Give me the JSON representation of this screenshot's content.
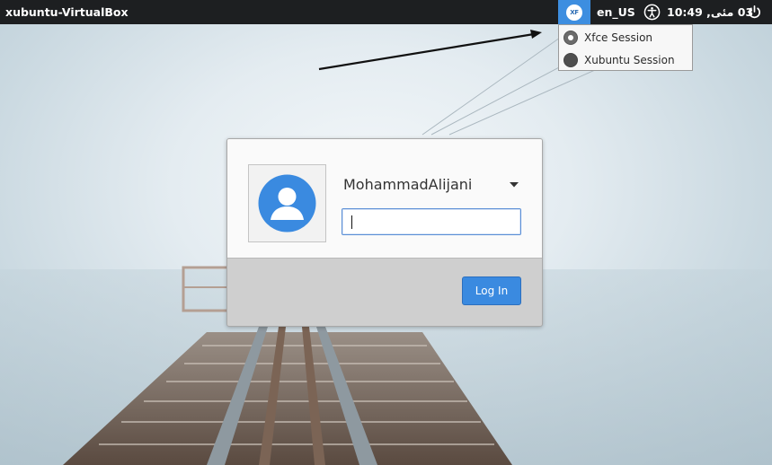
{
  "panel": {
    "hostname": "xubuntu-VirtualBox",
    "session_icon_text": "XF",
    "language": "en_US",
    "accessibility_icon": "accessibility-icon",
    "clock": "03 مئی, 10:49",
    "power_icon": "power-icon"
  },
  "session_menu": {
    "items": [
      {
        "label": "Xfce Session",
        "selected": true
      },
      {
        "label": "Xubuntu Session",
        "selected": false
      }
    ]
  },
  "login": {
    "username": "MohammadAlijani",
    "password_value": "",
    "login_label": "Log In",
    "avatar_icon": "user-avatar-icon",
    "dropdown_icon": "caret-down-icon"
  },
  "colors": {
    "panel_bg": "#1d1f21",
    "accent": "#3a8ae0",
    "dialog_bg": "#fafafa",
    "dialog_footer": "#cfcfcf"
  }
}
